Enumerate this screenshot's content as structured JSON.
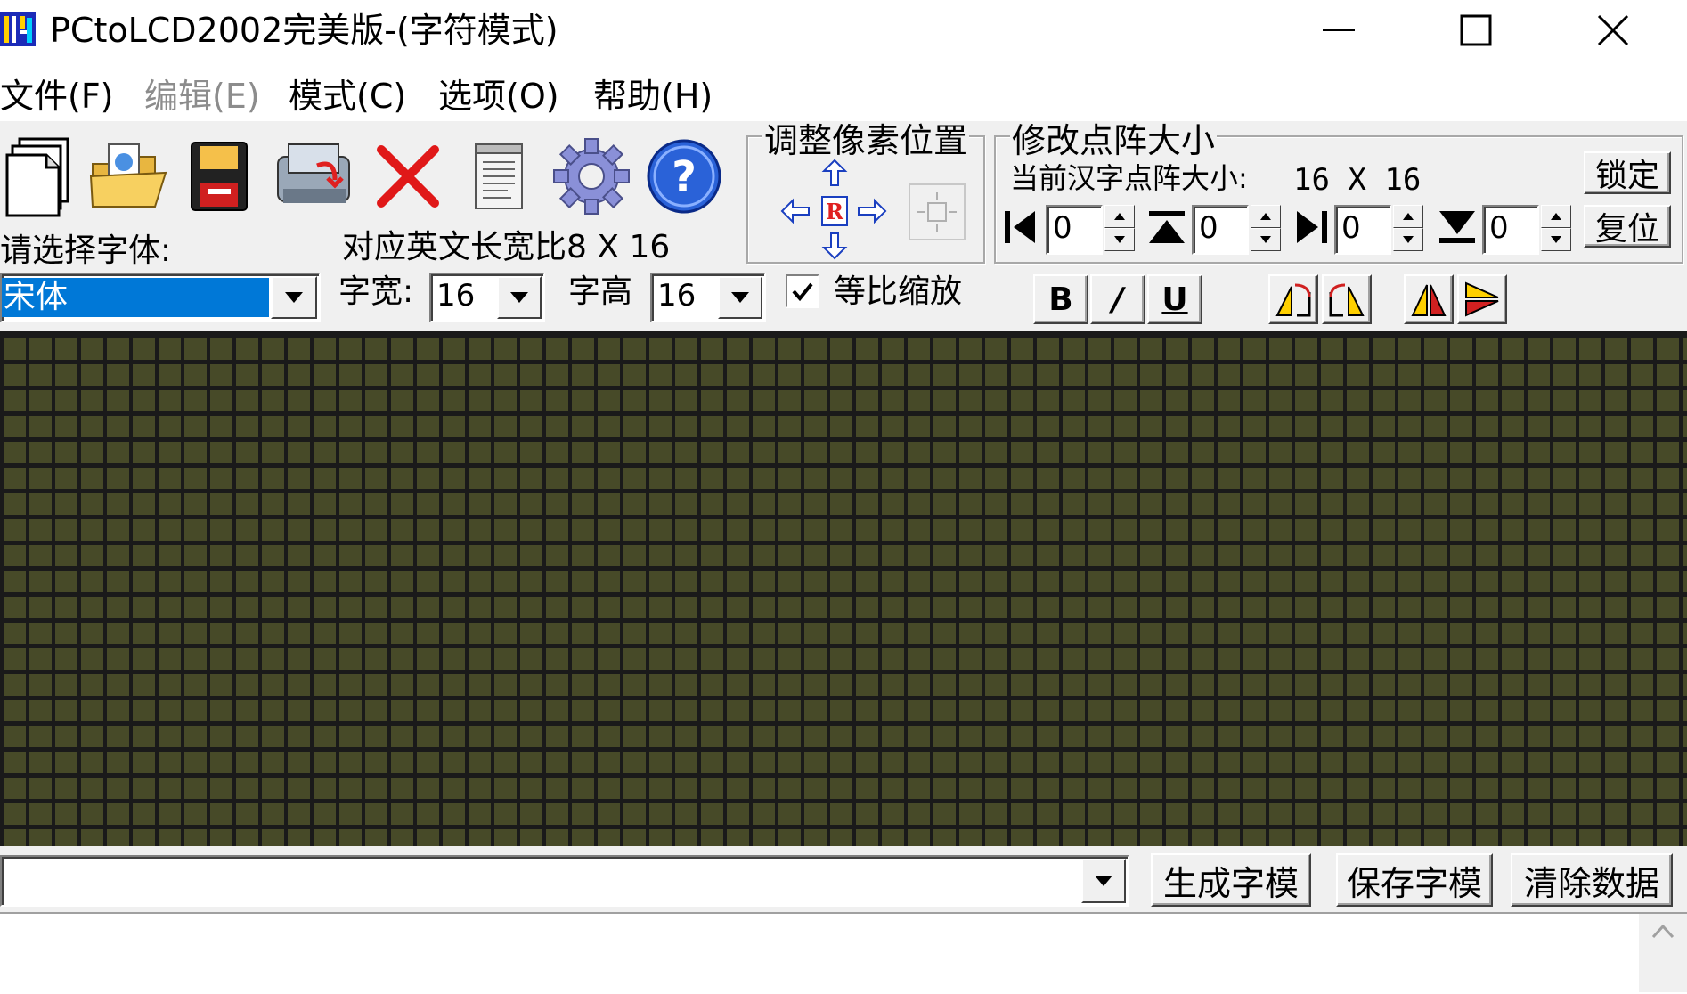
{
  "window": {
    "title": "PCtoLCD2002完美版-(字符模式)",
    "minimize_glyph": "—",
    "maximize_glyph": "☐",
    "close_glyph": "✕"
  },
  "menu": {
    "items": [
      {
        "label": "文件(F)",
        "enabled": true
      },
      {
        "label": "编辑(E)",
        "enabled": false
      },
      {
        "label": "模式(C)",
        "enabled": true
      },
      {
        "label": "选项(O)",
        "enabled": true
      },
      {
        "label": "帮助(H)",
        "enabled": true
      }
    ]
  },
  "toolbar": {
    "icons": [
      "new-file-icon",
      "open-folder-icon",
      "save-disk-icon",
      "import-image-icon",
      "delete-x-icon",
      "notepad-icon",
      "settings-gear-icon",
      "help-question-icon"
    ]
  },
  "pixel_adjust": {
    "title": "调整像素位置",
    "center_label": "R"
  },
  "dot_matrix": {
    "title": "修改点阵大小",
    "current_label": "当前汉字点阵大小:",
    "current_value": "16 X 16",
    "lock_button": "锁定",
    "reset_button": "复位",
    "spin_values": [
      "0",
      "0",
      "0",
      "0"
    ]
  },
  "font": {
    "select_label": "请选择字体:",
    "aspect_label": "对应英文长宽比8 X 16",
    "selected_font": "宋体",
    "width_label": "字宽:",
    "width_value": "16",
    "height_label": "字高",
    "height_value": "16",
    "proportional_label": "等比缩放",
    "proportional_checked": true
  },
  "style_buttons": {
    "bold": "B",
    "italic": "/",
    "underline": "U"
  },
  "actions": {
    "generate": "生成字模",
    "save": "保存字模",
    "clear": "清除数据",
    "input_value": ""
  },
  "colors": {
    "grid_cell": "#474a28",
    "grid_line": "#1a1a1a",
    "selection": "#0078d7",
    "face": "#f0f0f0"
  }
}
